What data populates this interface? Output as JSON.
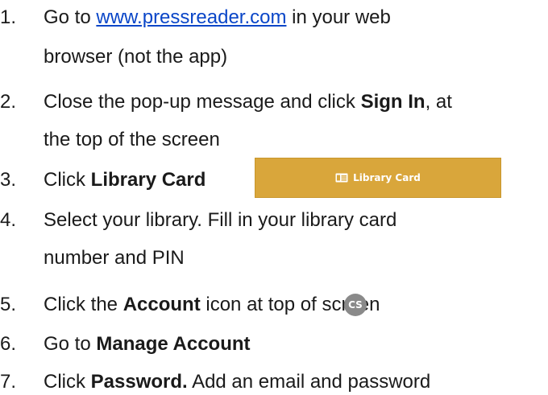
{
  "steps": [
    {
      "number": "1.",
      "pre": "Go to ",
      "link": "www.pressreader.com",
      "post": " in your web",
      "cont": "browser (not the app)"
    },
    {
      "number": "2.",
      "pre": "Close the pop-up message and click ",
      "bold": "Sign In",
      "post": ", at",
      "cont": "the top of the screen"
    },
    {
      "number": "3.",
      "pre": "Click ",
      "bold": "Library Card",
      "button_label": "Library Card"
    },
    {
      "number": "4.",
      "line1": "Select your library. Fill in your library card",
      "cont": "number and PIN"
    },
    {
      "number": "5.",
      "pre": "Click the ",
      "bold": "Account",
      "post": " icon at top of screen",
      "avatar_initials": "CS"
    },
    {
      "number": "6.",
      "pre": "Go to ",
      "bold": "Manage Account"
    },
    {
      "number": "7.",
      "pre": "Click ",
      "bold": "Password.",
      "post": " Add an email and password"
    }
  ],
  "colors": {
    "link": "#0a46c8",
    "button_bg": "#d9a63b",
    "avatar_bg": "#8a8a8a"
  }
}
